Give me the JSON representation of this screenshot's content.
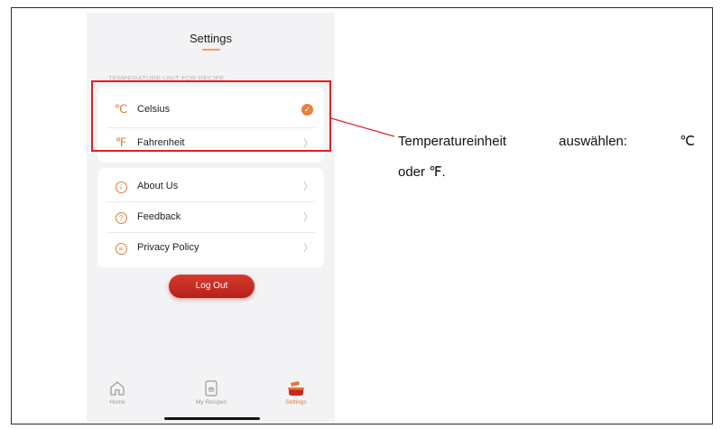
{
  "header": {
    "title": "Settings"
  },
  "temperature_section": {
    "label": "TEMPERATURE UNIT FOR RECIPE",
    "items": [
      {
        "symbol": "℃",
        "label": "Celsius",
        "selected": true
      },
      {
        "symbol": "℉",
        "label": "Fahrenheit",
        "selected": false
      }
    ]
  },
  "info_section": {
    "items": [
      {
        "icon": "info-icon",
        "glyph": "i",
        "label": "About Us"
      },
      {
        "icon": "question-icon",
        "glyph": "?",
        "label": "Feedback"
      },
      {
        "icon": "document-icon",
        "glyph": "≡",
        "label": "Privacy Policy"
      }
    ]
  },
  "logout_label": "Log Out",
  "tabbar": {
    "items": [
      {
        "label": "Home",
        "icon": "home-icon",
        "active": false
      },
      {
        "label": "My Recipes",
        "icon": "recipe-book-icon",
        "active": false
      },
      {
        "label": "Settings",
        "icon": "settings-pot-icon",
        "active": true
      }
    ]
  },
  "annotation": {
    "line1_words": [
      "Temperatureinheit",
      "auswählen:",
      "℃"
    ],
    "line2": "oder ℉."
  },
  "colors": {
    "accent": "#e07a3a",
    "logout": "#c8281f",
    "highlight": "#e61e1e"
  }
}
